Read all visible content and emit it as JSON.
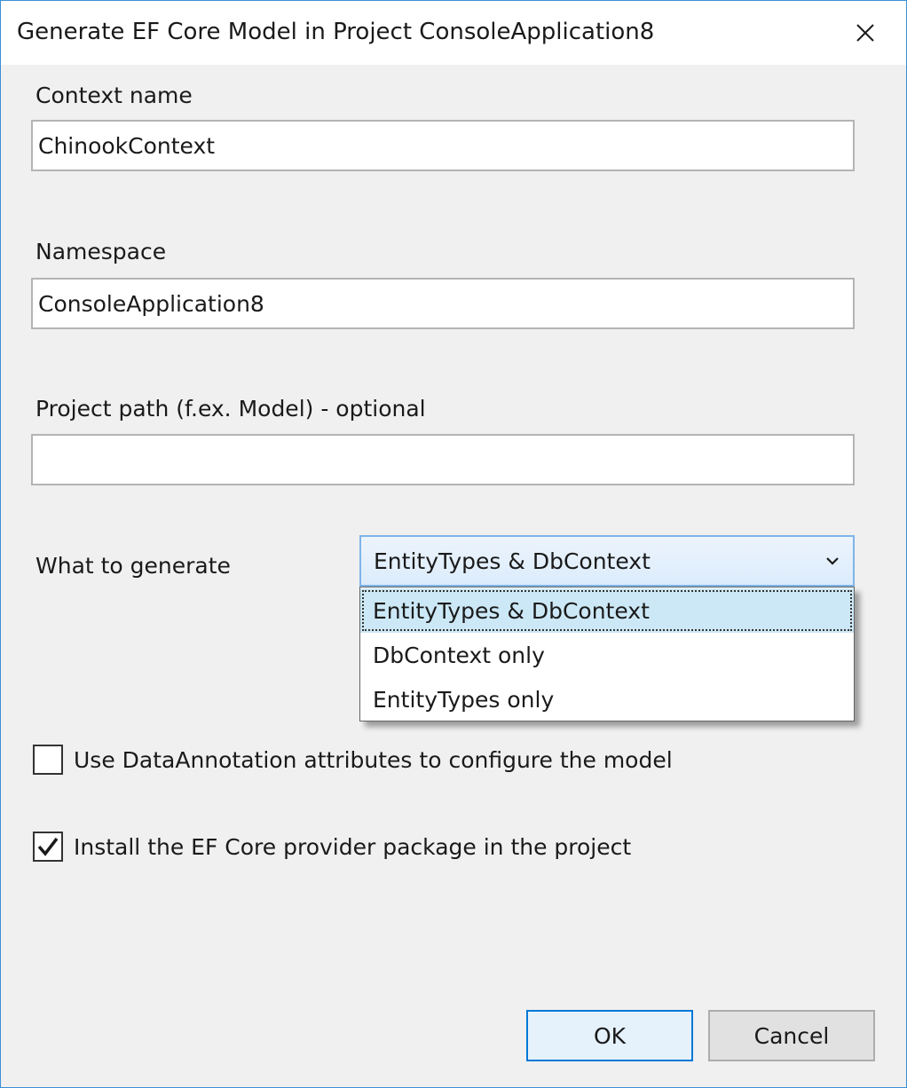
{
  "window": {
    "title": "Generate EF Core Model in Project ConsoleApplication8"
  },
  "fields": {
    "context_name_label": "Context name",
    "context_name_value": "ChinookContext",
    "namespace_label": "Namespace",
    "namespace_value": "ConsoleApplication8",
    "project_path_label": "Project path (f.ex. Model) - optional",
    "project_path_value": ""
  },
  "generate": {
    "label": "What to generate",
    "selected": "EntityTypes & DbContext",
    "options": [
      "EntityTypes & DbContext",
      "DbContext only",
      "EntityTypes only"
    ]
  },
  "checkboxes": {
    "data_annotation_label": "Use DataAnnotation attributes to configure the model",
    "data_annotation_checked": false,
    "install_provider_label": "Install the EF Core provider package in the project",
    "install_provider_checked": true
  },
  "buttons": {
    "ok": "OK",
    "cancel": "Cancel"
  },
  "colors": {
    "accent": "#0078d7",
    "selection": "#cce8f6"
  },
  "icons": {
    "close": "close-icon",
    "dropdown": "chevron-down-icon",
    "check": "checkmark-icon"
  }
}
